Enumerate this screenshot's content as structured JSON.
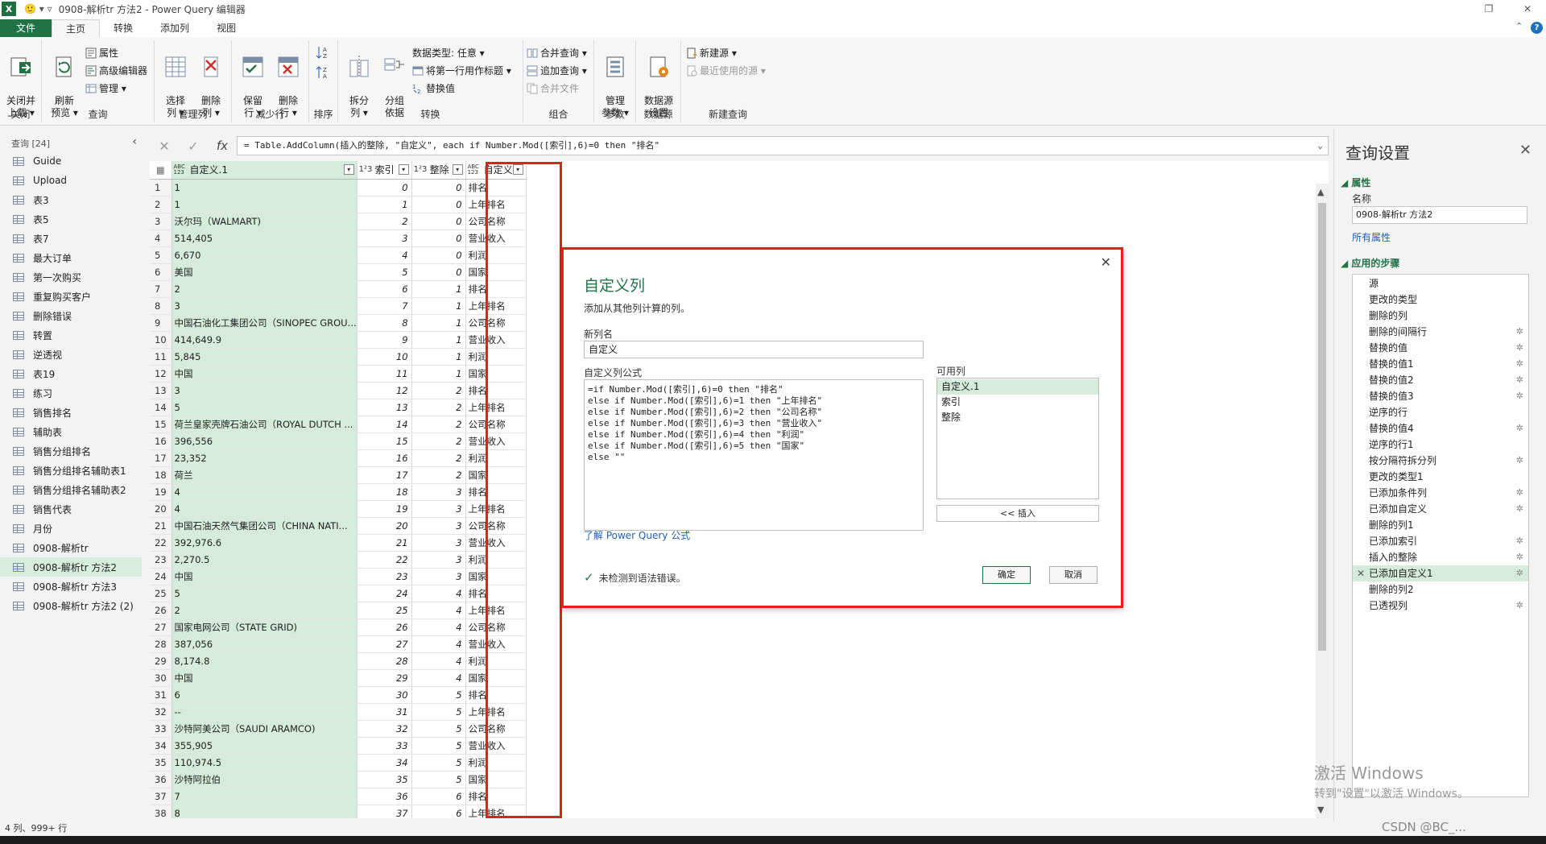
{
  "window": {
    "app_badge": "X",
    "quick_access": "🙂 ▾ ▿",
    "title": "0908-解析tr 方法2 - Power Query 编辑器",
    "restore": "❐",
    "close": "✕"
  },
  "tabs": [
    "文件",
    "主页",
    "转换",
    "添加列",
    "视图"
  ],
  "tabs_right": {
    "collapse": "⌃",
    "help": "?"
  },
  "ribbon": {
    "groups": {
      "close": "关闭",
      "query": "查询",
      "manage_cols": "管理列",
      "reduce_rows": "减少行",
      "sort": "排序",
      "transform": "转换",
      "combine": "组合",
      "params": "参数",
      "datasource": "数据源",
      "newquery": "新建查询"
    },
    "close_load": "关闭并\n上载 ▾",
    "refresh": "刷新\n预览 ▾",
    "properties": "属性",
    "advanced_editor": "高级编辑器",
    "manage": "管理 ▾",
    "choose_cols": "选择\n列 ▾",
    "remove_cols": "删除\n列 ▾",
    "keep_rows": "保留\n行 ▾",
    "remove_rows": "删除\n行 ▾",
    "split_col": "拆分\n列 ▾",
    "group_by": "分组\n依据",
    "data_type": "数据类型: 任意 ▾",
    "first_row_header": "将第一行用作标题 ▾",
    "replace_values": "替换值",
    "merge_queries": "合并查询 ▾",
    "append_queries": "追加查询 ▾",
    "combine_files": "合并文件",
    "manage_params": "管理\n参数 ▾",
    "datasource_settings": "数据源\n设置",
    "new_source": "新建源 ▾",
    "recent_sources": "最近使用的源 ▾"
  },
  "queries": {
    "header": "查询 [24]",
    "collapse": "‹",
    "items": [
      "Guide",
      "Upload",
      "表3",
      "表5",
      "表7",
      "最大订单",
      "第一次购买",
      "重复购买客户",
      "删除错误",
      "转置",
      "逆透视",
      "表19",
      "练习",
      "销售排名",
      "辅助表",
      "销售分组排名",
      "销售分组排名辅助表1",
      "销售分组排名辅助表2",
      "销售代表",
      "月份",
      "0908-解析tr",
      "0908-解析tr 方法2",
      "0908-解析tr 方法3",
      "0908-解析tr 方法2 (2)"
    ],
    "selected_index": 21
  },
  "formula_bar": {
    "cancel": "✕",
    "confirm": "✓",
    "fx": "fx",
    "text": "= Table.AddColumn(插入的整除, \"自定义\", each if Number.Mod([索引],6)=0 then \"排名\"",
    "expand": "⌄"
  },
  "grid": {
    "corner": "▦",
    "filter_icon": "▾",
    "columns": [
      {
        "type": "ABC\n123",
        "name": "自定义.1"
      },
      {
        "type": "1²3",
        "name": "索引"
      },
      {
        "type": "1²3",
        "name": "整除"
      },
      {
        "type": "ABC\n123",
        "name": "自定义"
      }
    ],
    "rows": [
      [
        "1",
        "1",
        "0",
        "0",
        "排名"
      ],
      [
        "2",
        "1",
        "1",
        "0",
        "上年排名"
      ],
      [
        "3",
        "沃尔玛（WALMART)",
        "2",
        "0",
        "公司名称"
      ],
      [
        "4",
        "514,405",
        "3",
        "0",
        "营业收入"
      ],
      [
        "5",
        "6,670",
        "4",
        "0",
        "利润"
      ],
      [
        "6",
        "美国",
        "5",
        "0",
        "国家"
      ],
      [
        "7",
        "2",
        "6",
        "1",
        "排名"
      ],
      [
        "8",
        "3",
        "7",
        "1",
        "上年排名"
      ],
      [
        "9",
        "中国石油化工集团公司（SINOPEC GROU...",
        "8",
        "1",
        "公司名称"
      ],
      [
        "10",
        "414,649.9",
        "9",
        "1",
        "营业收入"
      ],
      [
        "11",
        "5,845",
        "10",
        "1",
        "利润"
      ],
      [
        "12",
        "中国",
        "11",
        "1",
        "国家"
      ],
      [
        "13",
        "3",
        "12",
        "2",
        "排名"
      ],
      [
        "14",
        "5",
        "13",
        "2",
        "上年排名"
      ],
      [
        "15",
        "荷兰皇家壳牌石油公司（ROYAL DUTCH ...",
        "14",
        "2",
        "公司名称"
      ],
      [
        "16",
        "396,556",
        "15",
        "2",
        "营业收入"
      ],
      [
        "17",
        "23,352",
        "16",
        "2",
        "利润"
      ],
      [
        "18",
        "荷兰",
        "17",
        "2",
        "国家"
      ],
      [
        "19",
        "4",
        "18",
        "3",
        "排名"
      ],
      [
        "20",
        "4",
        "19",
        "3",
        "上年排名"
      ],
      [
        "21",
        "中国石油天然气集团公司（CHINA NATI...",
        "20",
        "3",
        "公司名称"
      ],
      [
        "22",
        "392,976.6",
        "21",
        "3",
        "营业收入"
      ],
      [
        "23",
        "2,270.5",
        "22",
        "3",
        "利润"
      ],
      [
        "24",
        "中国",
        "23",
        "3",
        "国家"
      ],
      [
        "25",
        "5",
        "24",
        "4",
        "排名"
      ],
      [
        "26",
        "2",
        "25",
        "4",
        "上年排名"
      ],
      [
        "27",
        "国家电网公司（STATE GRID)",
        "26",
        "4",
        "公司名称"
      ],
      [
        "28",
        "387,056",
        "27",
        "4",
        "营业收入"
      ],
      [
        "29",
        "8,174.8",
        "28",
        "4",
        "利润"
      ],
      [
        "30",
        "中国",
        "29",
        "4",
        "国家"
      ],
      [
        "31",
        "6",
        "30",
        "5",
        "排名"
      ],
      [
        "32",
        "--",
        "31",
        "5",
        "上年排名"
      ],
      [
        "33",
        "沙特阿美公司（SAUDI ARAMCO)",
        "32",
        "5",
        "公司名称"
      ],
      [
        "34",
        "355,905",
        "33",
        "5",
        "营业收入"
      ],
      [
        "35",
        "110,974.5",
        "34",
        "5",
        "利润"
      ],
      [
        "36",
        "沙特阿拉伯",
        "35",
        "5",
        "国家"
      ],
      [
        "37",
        "7",
        "36",
        "6",
        "排名"
      ],
      [
        "38",
        "8",
        "37",
        "6",
        "上年排名"
      ]
    ]
  },
  "scrollbar": {
    "up": "▲",
    "down": "▼"
  },
  "status": "4 列、999+ 行",
  "settings": {
    "title": "查询设置",
    "close": "✕",
    "properties_header": "◢ 属性",
    "name_label": "名称",
    "name_value": "0908-解析tr 方法2",
    "all_properties": "所有属性",
    "steps_header": "◢ 应用的步骤",
    "steps": [
      {
        "name": "源",
        "gear": false
      },
      {
        "name": "更改的类型",
        "gear": false
      },
      {
        "name": "删除的列",
        "gear": false
      },
      {
        "name": "删除的间隔行",
        "gear": true
      },
      {
        "name": "替换的值",
        "gear": true
      },
      {
        "name": "替换的值1",
        "gear": true
      },
      {
        "name": "替换的值2",
        "gear": true
      },
      {
        "name": "替换的值3",
        "gear": true
      },
      {
        "name": "逆序的行",
        "gear": false
      },
      {
        "name": "替换的值4",
        "gear": true
      },
      {
        "name": "逆序的行1",
        "gear": false
      },
      {
        "name": "按分隔符拆分列",
        "gear": true
      },
      {
        "name": "更改的类型1",
        "gear": false
      },
      {
        "name": "已添加条件列",
        "gear": true
      },
      {
        "name": "已添加自定义",
        "gear": true
      },
      {
        "name": "删除的列1",
        "gear": false
      },
      {
        "name": "已添加索引",
        "gear": true
      },
      {
        "name": "插入的整除",
        "gear": true
      },
      {
        "name": "已添加自定义1",
        "gear": true
      },
      {
        "name": "删除的列2",
        "gear": false
      },
      {
        "name": "已透视列",
        "gear": true
      }
    ],
    "active_step": 18,
    "delete_icon": "✕",
    "gear_icon": "✲"
  },
  "watermark": {
    "line1": "激活 Windows",
    "line2": "转到\"设置\"以激活 Windows。"
  },
  "csdn": "CSDN @BC_...",
  "dialog": {
    "close": "✕",
    "title": "自定义列",
    "subtitle": "添加从其他列计算的列。",
    "new_col_label": "新列名",
    "new_col_value": "自定义",
    "formula_label": "自定义列公式",
    "formula": "=if Number.Mod([索引],6)=0 then \"排名\"\nelse if Number.Mod([索引],6)=1 then \"上年排名\"\nelse if Number.Mod([索引],6)=2 then \"公司名称\"\nelse if Number.Mod([索引],6)=3 then \"营业收入\"\nelse if Number.Mod([索引],6)=4 then \"利润\"\nelse if Number.Mod([索引],6)=5 then \"国家\"\nelse \"\"",
    "available_label": "可用列",
    "available": [
      "自定义.1",
      "索引",
      "整除"
    ],
    "insert": "<< 插入",
    "learn": "了解 Power Query 公式",
    "status_check": "✓",
    "status": "未检测到语法错误。",
    "ok": "确定",
    "cancel": "取消"
  }
}
